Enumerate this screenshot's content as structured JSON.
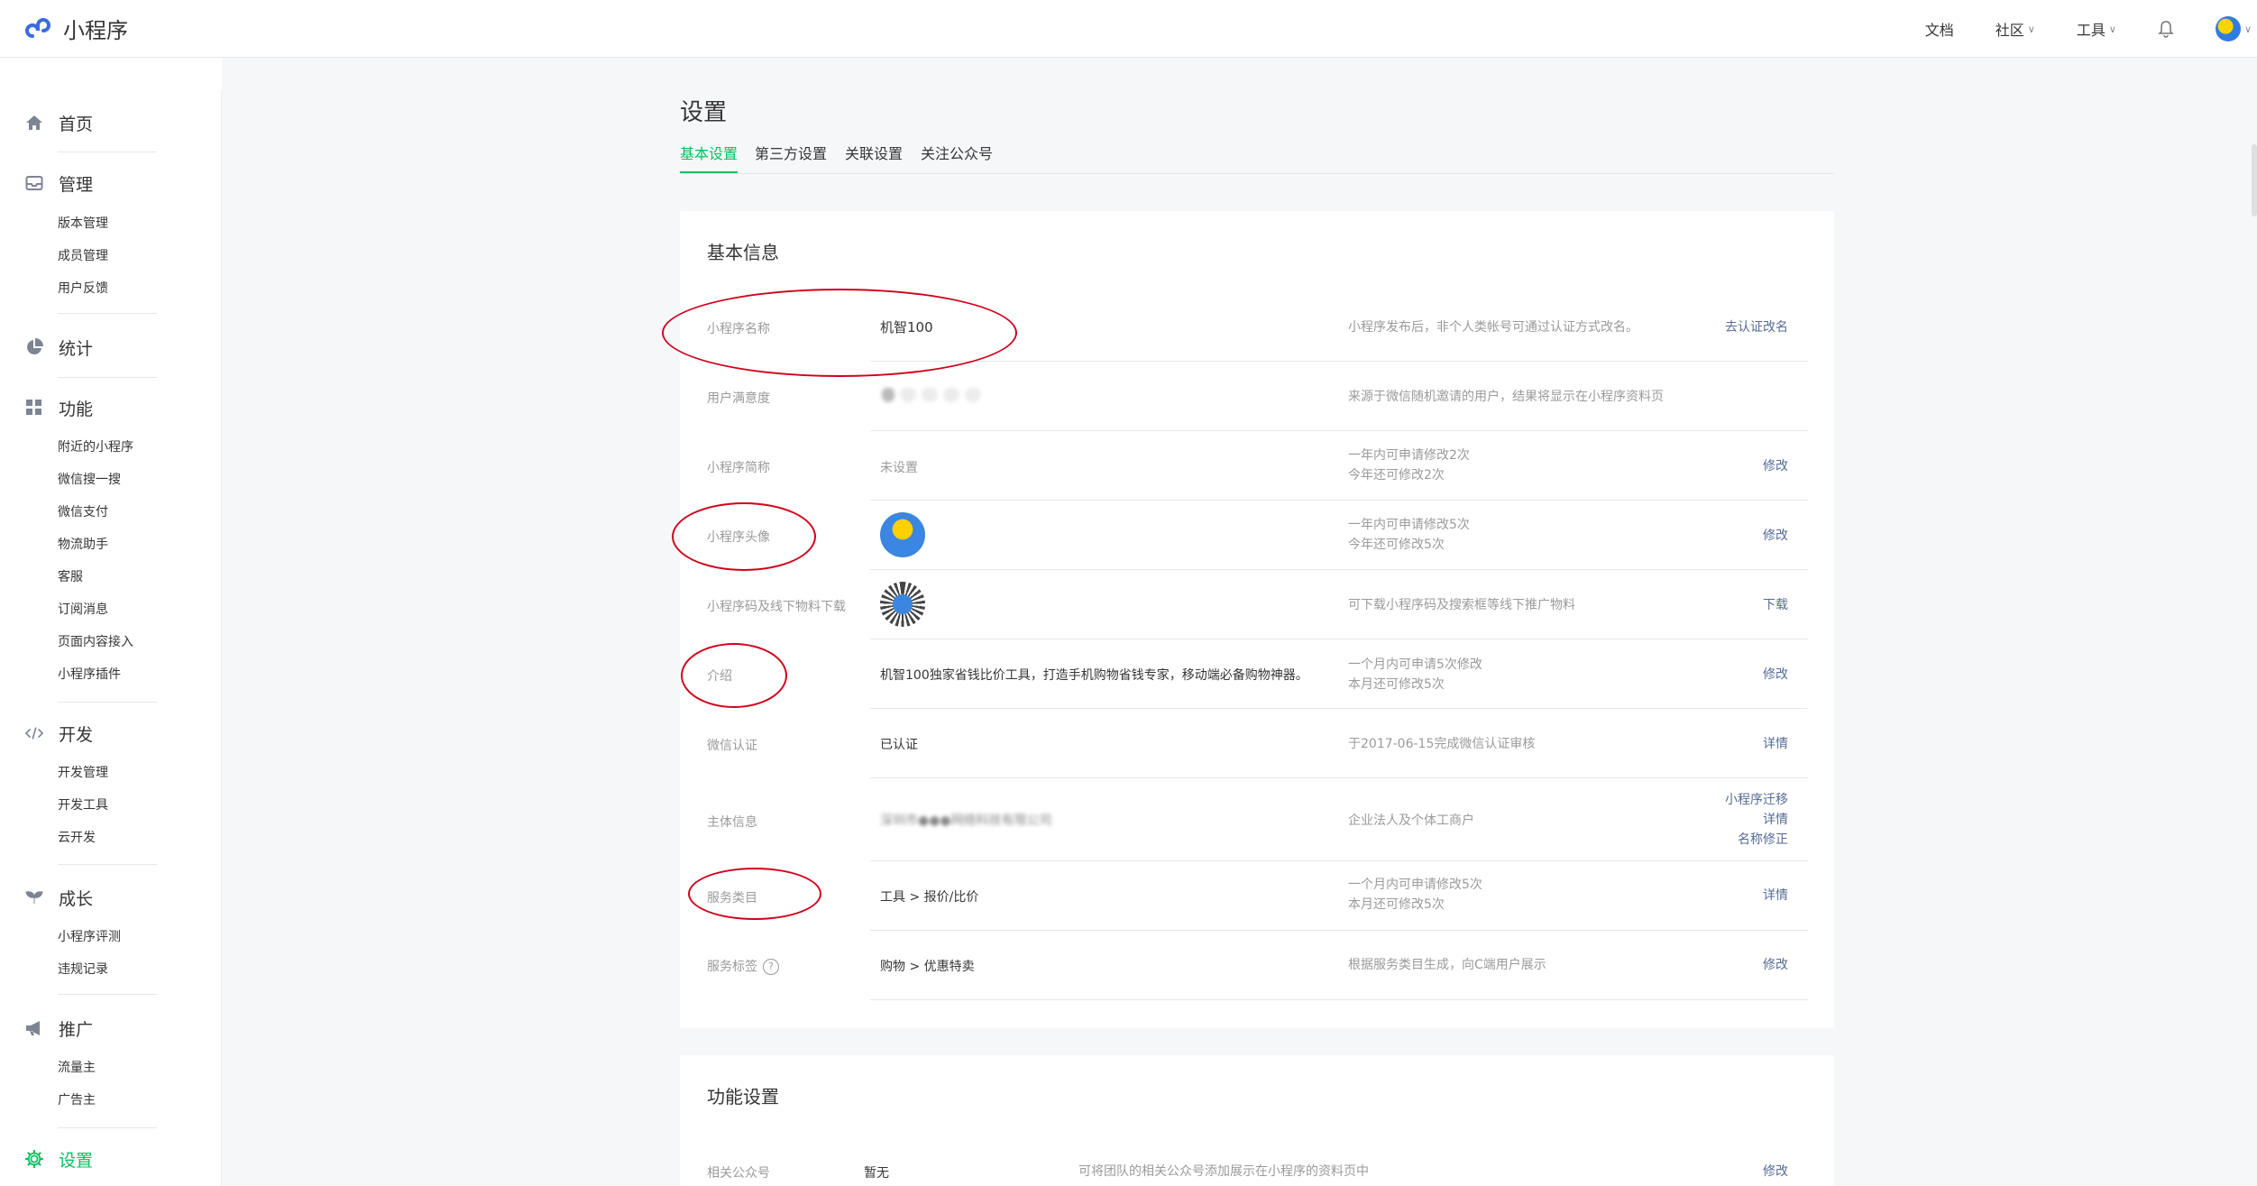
{
  "header": {
    "app_title": "小程序",
    "nav": [
      {
        "label": "文档"
      },
      {
        "label": "社区"
      },
      {
        "label": "工具"
      }
    ]
  },
  "sidebar": {
    "sections": [
      {
        "label": "首页",
        "icon": "home-icon",
        "items": []
      },
      {
        "label": "管理",
        "icon": "inbox-icon",
        "items": [
          "版本管理",
          "成员管理",
          "用户反馈"
        ]
      },
      {
        "label": "统计",
        "icon": "pie-chart-icon",
        "items": []
      },
      {
        "label": "功能",
        "icon": "grid-icon",
        "items": [
          "附近的小程序",
          "微信搜一搜",
          "微信支付",
          "物流助手",
          "客服",
          "订阅消息",
          "页面内容接入",
          "小程序插件"
        ]
      },
      {
        "label": "开发",
        "icon": "code-icon",
        "items": [
          "开发管理",
          "开发工具",
          "云开发"
        ]
      },
      {
        "label": "成长",
        "icon": "sprout-icon",
        "items": [
          "小程序评测",
          "违规记录"
        ]
      },
      {
        "label": "推广",
        "icon": "megaphone-icon",
        "items": [
          "流量主",
          "广告主"
        ]
      },
      {
        "label": "设置",
        "icon": "gear-icon",
        "items": [],
        "active": true
      }
    ]
  },
  "main": {
    "title": "设置",
    "tabs": [
      {
        "label": "基本设置",
        "active": true
      },
      {
        "label": "第三方设置"
      },
      {
        "label": "关联设置"
      },
      {
        "label": "关注公众号"
      }
    ],
    "basic_info": {
      "title": "基本信息",
      "rows": [
        {
          "label": "小程序名称",
          "value": "机智100",
          "desc": [
            "小程序发布后，非个人类帐号可通过认证方式改名。"
          ],
          "actions": [
            "去认证改名"
          ]
        },
        {
          "label": "用户满意度",
          "value": "",
          "desc": [
            "来源于微信随机邀请的用户，结果将显示在小程序资料页"
          ],
          "actions": []
        },
        {
          "label": "小程序简称",
          "value": "未设置",
          "desc": [
            "一年内可申请修改2次",
            "今年还可修改2次"
          ],
          "actions": [
            "修改"
          ]
        },
        {
          "label": "小程序头像",
          "value": "",
          "desc": [
            "一年内可申请修改5次",
            "今年还可修改5次"
          ],
          "actions": [
            "修改"
          ]
        },
        {
          "label": "小程序码及线下物料下载",
          "value": "",
          "desc": [
            "可下载小程序码及搜索框等线下推广物料"
          ],
          "actions": [
            "下载"
          ]
        },
        {
          "label": "介绍",
          "value": "机智100独家省钱比价工具，打造手机购物省钱专家，移动端必备购物神器。",
          "desc": [
            "一个月内可申请5次修改",
            "本月还可修改5次"
          ],
          "actions": [
            "修改"
          ]
        },
        {
          "label": "微信认证",
          "value": "已认证",
          "desc": [
            "于2017-06-15完成微信认证审核"
          ],
          "actions": [
            "详情"
          ]
        },
        {
          "label": "主体信息",
          "value": "深圳市●●●网络科技有限公司",
          "desc": [
            "企业法人及个体工商户"
          ],
          "actions": [
            "小程序迁移",
            "详情",
            "名称修正"
          ]
        },
        {
          "label": "服务类目",
          "value": "工具 > 报价/比价",
          "desc": [
            "一个月内可申请修改5次",
            "本月还可修改5次"
          ],
          "actions": [
            "详情"
          ]
        },
        {
          "label": "服务标签",
          "value": "购物 > 优惠特卖",
          "desc": [
            "根据服务类目生成，向C端用户展示"
          ],
          "actions": [
            "修改"
          ]
        }
      ]
    },
    "function_settings": {
      "title": "功能设置",
      "rows": [
        {
          "label": "相关公众号",
          "value": "暂无",
          "desc": "可将团队的相关公众号添加展示在小程序的资料页中",
          "action": "修改"
        }
      ]
    }
  },
  "colors": {
    "accent": "#07c160",
    "link": "#576b95",
    "annotation": "#d0021b"
  }
}
